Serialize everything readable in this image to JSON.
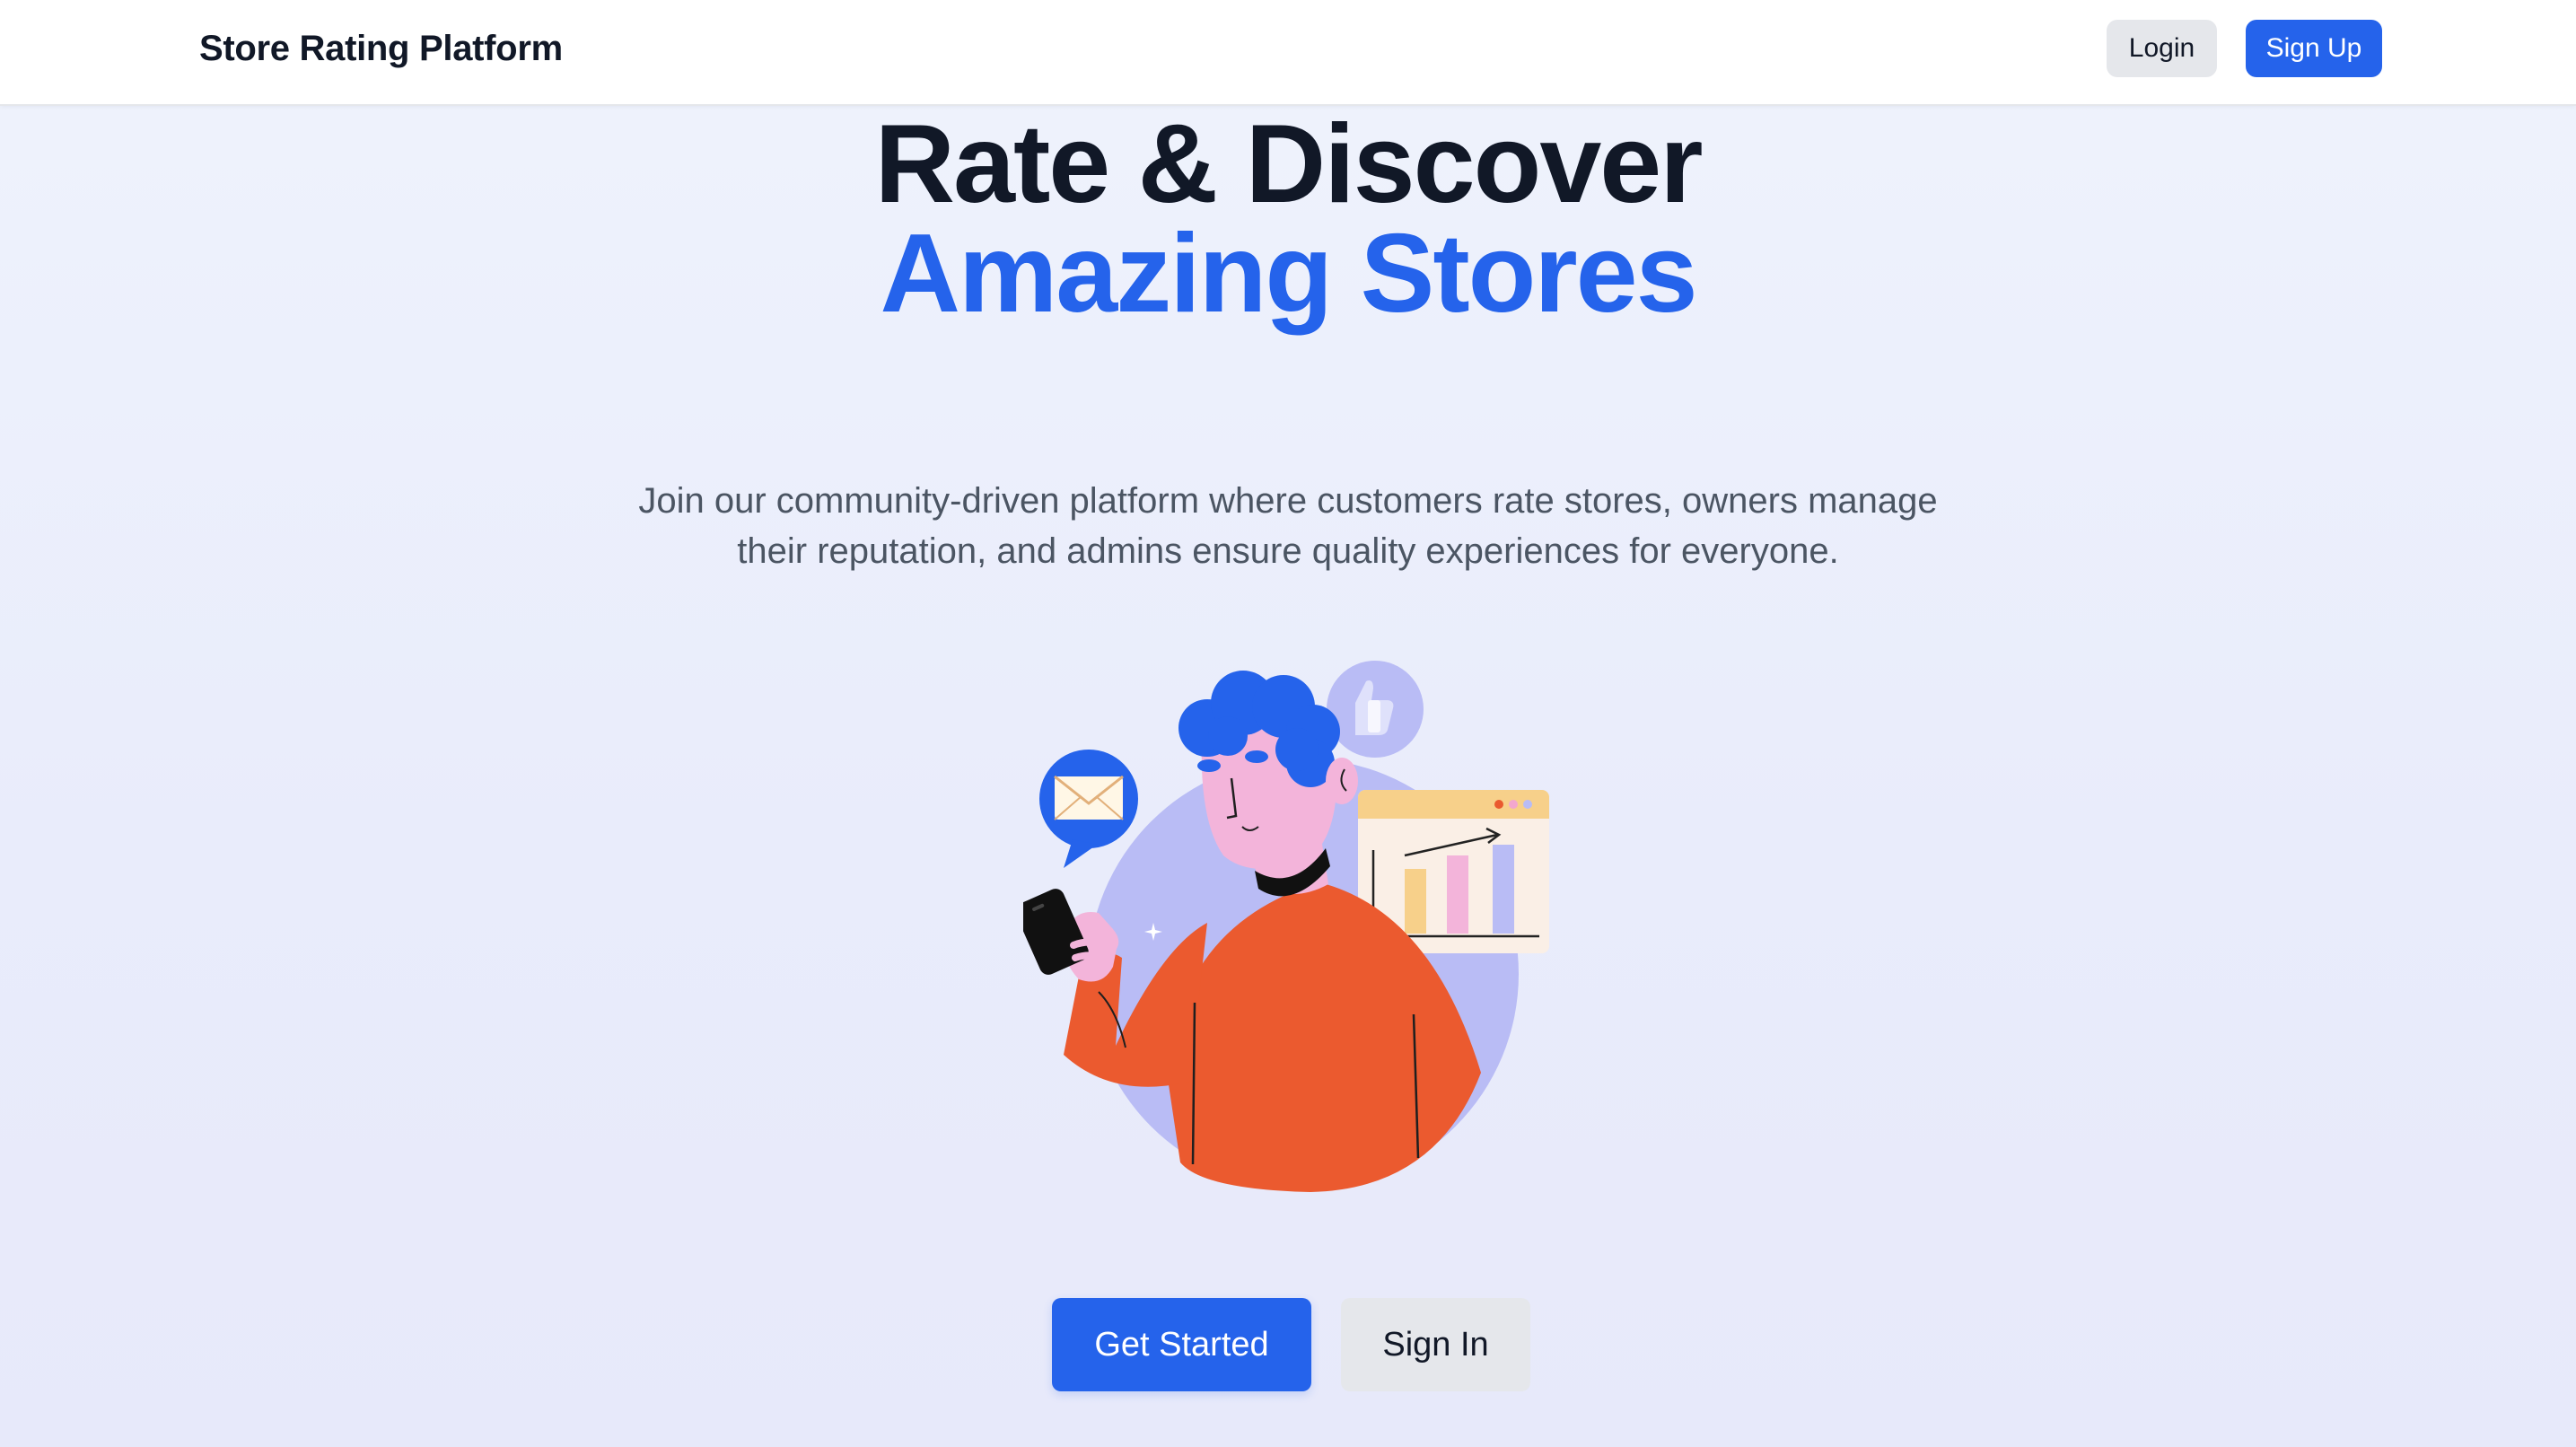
{
  "navbar": {
    "brand": "Store Rating Platform",
    "login_label": "Login",
    "signup_label": "Sign Up"
  },
  "hero": {
    "headline_line1": "Rate & Discover",
    "headline_line2": "Amazing Stores",
    "subtitle_line1": "Join our community-driven platform where customers rate stores, owners manage",
    "subtitle_line2": "their reputation, and admins ensure quality experiences for everyone.",
    "illustration_icon": "person-rating-stores-illustration",
    "primary_cta": "Get Started",
    "secondary_cta": "Sign In"
  },
  "colors": {
    "accent": "#2563eb",
    "heading": "#111827",
    "body_text": "#4b5563",
    "secondary_button": "#e5e7eb",
    "hero_background": "#eaedfb"
  }
}
